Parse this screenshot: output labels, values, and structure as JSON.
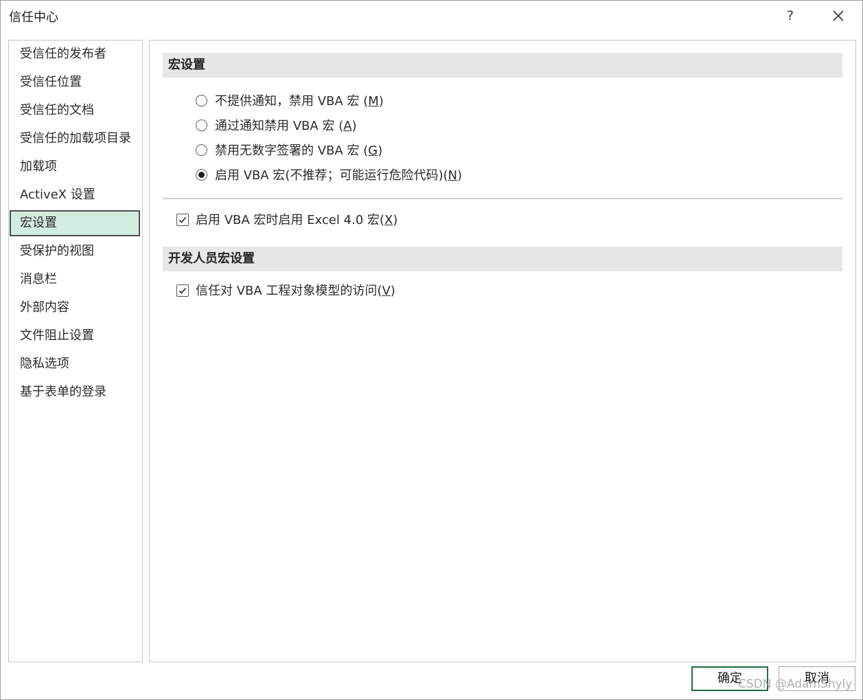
{
  "window": {
    "title": "信任中心",
    "help_label": "?"
  },
  "sidebar": {
    "items": [
      {
        "label": "受信任的发布者"
      },
      {
        "label": "受信任位置"
      },
      {
        "label": "受信任的文档"
      },
      {
        "label": "受信任的加载项目录"
      },
      {
        "label": "加载项"
      },
      {
        "label": "ActiveX 设置"
      },
      {
        "label": "宏设置",
        "selected": true
      },
      {
        "label": "受保护的视图"
      },
      {
        "label": "消息栏"
      },
      {
        "label": "外部内容"
      },
      {
        "label": "文件阻止设置"
      },
      {
        "label": "隐私选项"
      },
      {
        "label": "基于表单的登录"
      }
    ]
  },
  "macro_settings": {
    "header": "宏设置",
    "options": [
      {
        "text": "不提供通知，禁用 VBA 宏 (",
        "key": "M",
        "suffix": ")",
        "selected": false
      },
      {
        "text": "通过通知禁用 VBA 宏 (",
        "key": "A",
        "suffix": ")",
        "selected": false
      },
      {
        "text": "禁用无数字签署的 VBA 宏 (",
        "key": "G",
        "suffix": ")",
        "selected": false
      },
      {
        "text": "启用 VBA 宏(不推荐；可能运行危险代码)(",
        "key": "N",
        "suffix": ")",
        "selected": true
      }
    ],
    "excel4": {
      "text": "启用 VBA 宏时启用 Excel 4.0 宏(",
      "key": "X",
      "suffix": ")",
      "checked": true
    }
  },
  "developer_settings": {
    "header": "开发人员宏设置",
    "trust_vba": {
      "text": "信任对 VBA 工程对象模型的访问(",
      "key": "V",
      "suffix": ")",
      "checked": true
    }
  },
  "buttons": {
    "ok": "确定",
    "cancel": "取消"
  },
  "watermark": "CSDN @AdamShyly",
  "colors": {
    "selected_nav_bg": "#d2ede0",
    "section_header_bg": "#e7e7e7",
    "primary_button_border": "#1e6c41"
  }
}
